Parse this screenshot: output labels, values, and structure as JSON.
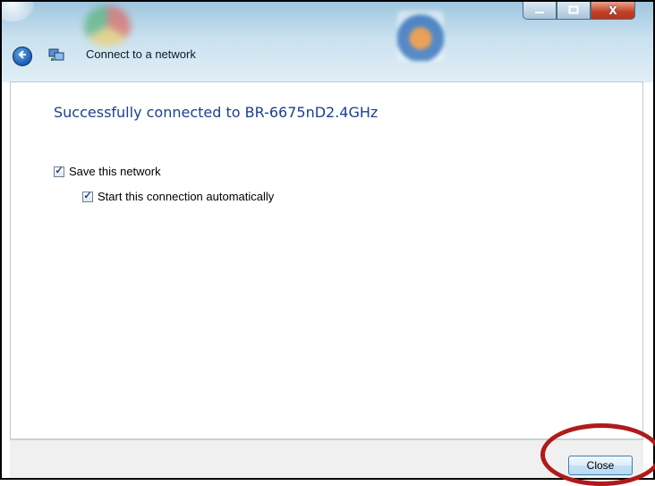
{
  "window": {
    "title": "Connect to a network",
    "controls": {
      "minimize_icon": "minimize-icon",
      "maximize_icon": "maximize-icon",
      "close_label": "X"
    }
  },
  "main": {
    "heading": "Successfully connected to BR-6675nD2.4GHz",
    "options": [
      {
        "label": "Save this network",
        "checked": true
      },
      {
        "label": "Start this connection automatically",
        "checked": true
      }
    ]
  },
  "footer": {
    "close_label": "Close"
  },
  "icons": {
    "back": "back-arrow-icon",
    "network": "network-icon"
  },
  "colors": {
    "heading": "#1e3f8c",
    "highlight": "#b01a1a",
    "close_control": "#c23f23"
  }
}
